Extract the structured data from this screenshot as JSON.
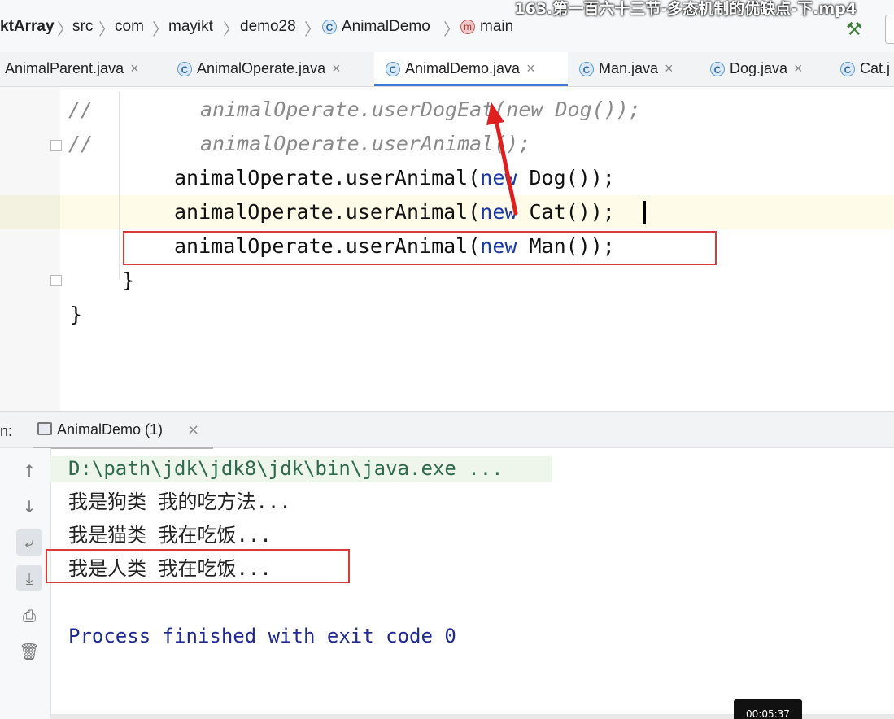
{
  "video_title": "163.第一百六十三节-多态机制的优缺点-下.mp4",
  "breadcrumb": {
    "items": [
      {
        "label": "ktArray",
        "kind": "text"
      },
      {
        "label": "src",
        "kind": "text"
      },
      {
        "label": "com",
        "kind": "text"
      },
      {
        "label": "mayikt",
        "kind": "text"
      },
      {
        "label": "demo28",
        "kind": "text"
      },
      {
        "label": "AnimalDemo",
        "kind": "class-icon"
      },
      {
        "label": "main",
        "kind": "method-icon"
      }
    ]
  },
  "tabs": [
    {
      "label": "AnimalParent.java",
      "active": false
    },
    {
      "label": "AnimalOperate.java",
      "active": false
    },
    {
      "label": "AnimalDemo.java",
      "active": true
    },
    {
      "label": "Man.java",
      "active": false
    },
    {
      "label": "Dog.java",
      "active": false
    },
    {
      "label": "Cat.j",
      "active": false
    }
  ],
  "code": {
    "line1_comment": "//",
    "line1_text": "animalOperate.userDogEat(new Dog());",
    "line2_comment": "//",
    "line2_text": "animalOperate.userAnimal();",
    "line3_pre": "animalOperate.userAnimal(",
    "line3_kw": "new",
    "line3_post": " Dog());",
    "line4_pre": "animalOperate.userAnimal(",
    "line4_kw": "new",
    "line4_post": " Cat());",
    "line5_pre": "animalOperate.userAnimal(",
    "line5_kw": "new",
    "line5_post": " Man());",
    "line6": "}",
    "line7": "}"
  },
  "run_panel": {
    "label": "n:",
    "tab_label": "AnimalDemo (1)",
    "console": {
      "command": "D:\\path\\jdk\\jdk8\\jdk\\bin\\java.exe ...",
      "out1": "我是狗类 我的吃方法...",
      "out2": "我是猫类 我在吃饭...",
      "out3": "我是人类 我在吃饭...",
      "finished": "Process finished with exit code 0"
    }
  },
  "timestamp": "00:05:37",
  "colors": {
    "keyword": "#1c39a8",
    "comment": "#8a8a8a",
    "annotation_red": "#d93a3a",
    "active_tab_underline": "#3d7bd4",
    "process_finished": "#1f2a8f"
  },
  "icons": {
    "class_icon": "class-icon",
    "method_icon": "method-icon",
    "build_icon": "hammer-icon"
  }
}
